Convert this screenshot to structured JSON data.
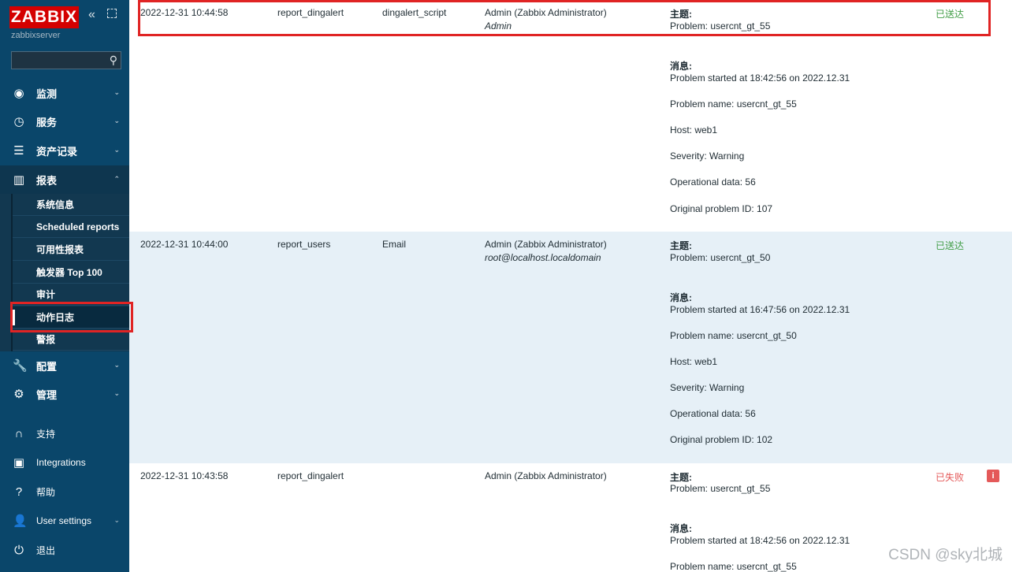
{
  "sidebar": {
    "logo": "ZABBIX",
    "server": "zabbixserver",
    "search_placeholder": "",
    "menu": [
      {
        "label": "监测",
        "icon": "eye-icon"
      },
      {
        "label": "服务",
        "icon": "stopwatch-icon"
      },
      {
        "label": "资产记录",
        "icon": "list-icon"
      },
      {
        "label": "报表",
        "icon": "bar-chart-icon"
      },
      {
        "label": "配置",
        "icon": "wrench-icon"
      },
      {
        "label": "管理",
        "icon": "gear-icon"
      },
      {
        "label": "支持",
        "icon": "headset-icon"
      },
      {
        "label": "Integrations",
        "icon": "z-icon"
      },
      {
        "label": "帮助",
        "icon": "question-icon"
      },
      {
        "label": "User settings",
        "icon": "user-icon"
      },
      {
        "label": "退出",
        "icon": "power-icon"
      }
    ],
    "reports_submenu": [
      "系统信息",
      "Scheduled reports",
      "可用性报表",
      "触发器 Top 100",
      "审计",
      "动作日志",
      "警报"
    ]
  },
  "rows": [
    {
      "time": "2022-12-31 10:44:58",
      "action": "report_dingalert",
      "media_type": "dingalert_script",
      "recipient": "Admin (Zabbix Administrator)",
      "recipient_sub": "Admin",
      "subject_label": "主题:",
      "subject": "Problem: usercnt_gt_55",
      "message_label": "消息:",
      "message_lines": [
        "Problem started at 18:42:56 on 2022.12.31",
        "Problem name: usercnt_gt_55",
        "Host: web1",
        "Severity: Warning",
        "Operational data: 56",
        "Original problem ID: 107"
      ],
      "status": "已送达"
    },
    {
      "time": "2022-12-31 10:44:00",
      "action": "report_users",
      "media_type": "Email",
      "recipient": "Admin (Zabbix Administrator)",
      "recipient_sub": "root@localhost.localdomain",
      "subject_label": "主题:",
      "subject": "Problem: usercnt_gt_50",
      "message_label": "消息:",
      "message_lines": [
        "Problem started at 16:47:56 on 2022.12.31",
        "Problem name: usercnt_gt_50",
        "Host: web1",
        "Severity: Warning",
        "Operational data: 56",
        "Original problem ID: 102"
      ],
      "status": "已送达"
    },
    {
      "time": "2022-12-31 10:43:58",
      "action": "report_dingalert",
      "media_type": "",
      "recipient": "Admin (Zabbix Administrator)",
      "recipient_sub": "",
      "subject_label": "主题:",
      "subject": "Problem: usercnt_gt_55",
      "message_label": "消息:",
      "message_lines": [
        "Problem started at 18:42:56 on 2022.12.31",
        "Problem name: usercnt_gt_55"
      ],
      "status": "已失败",
      "info_icon": "i"
    }
  ],
  "watermark": "CSDN @sky北城",
  "colors": {
    "sidebar": "#0a466a",
    "ok": "#429e47",
    "fail": "#e45959",
    "highlight": "#e02424"
  }
}
